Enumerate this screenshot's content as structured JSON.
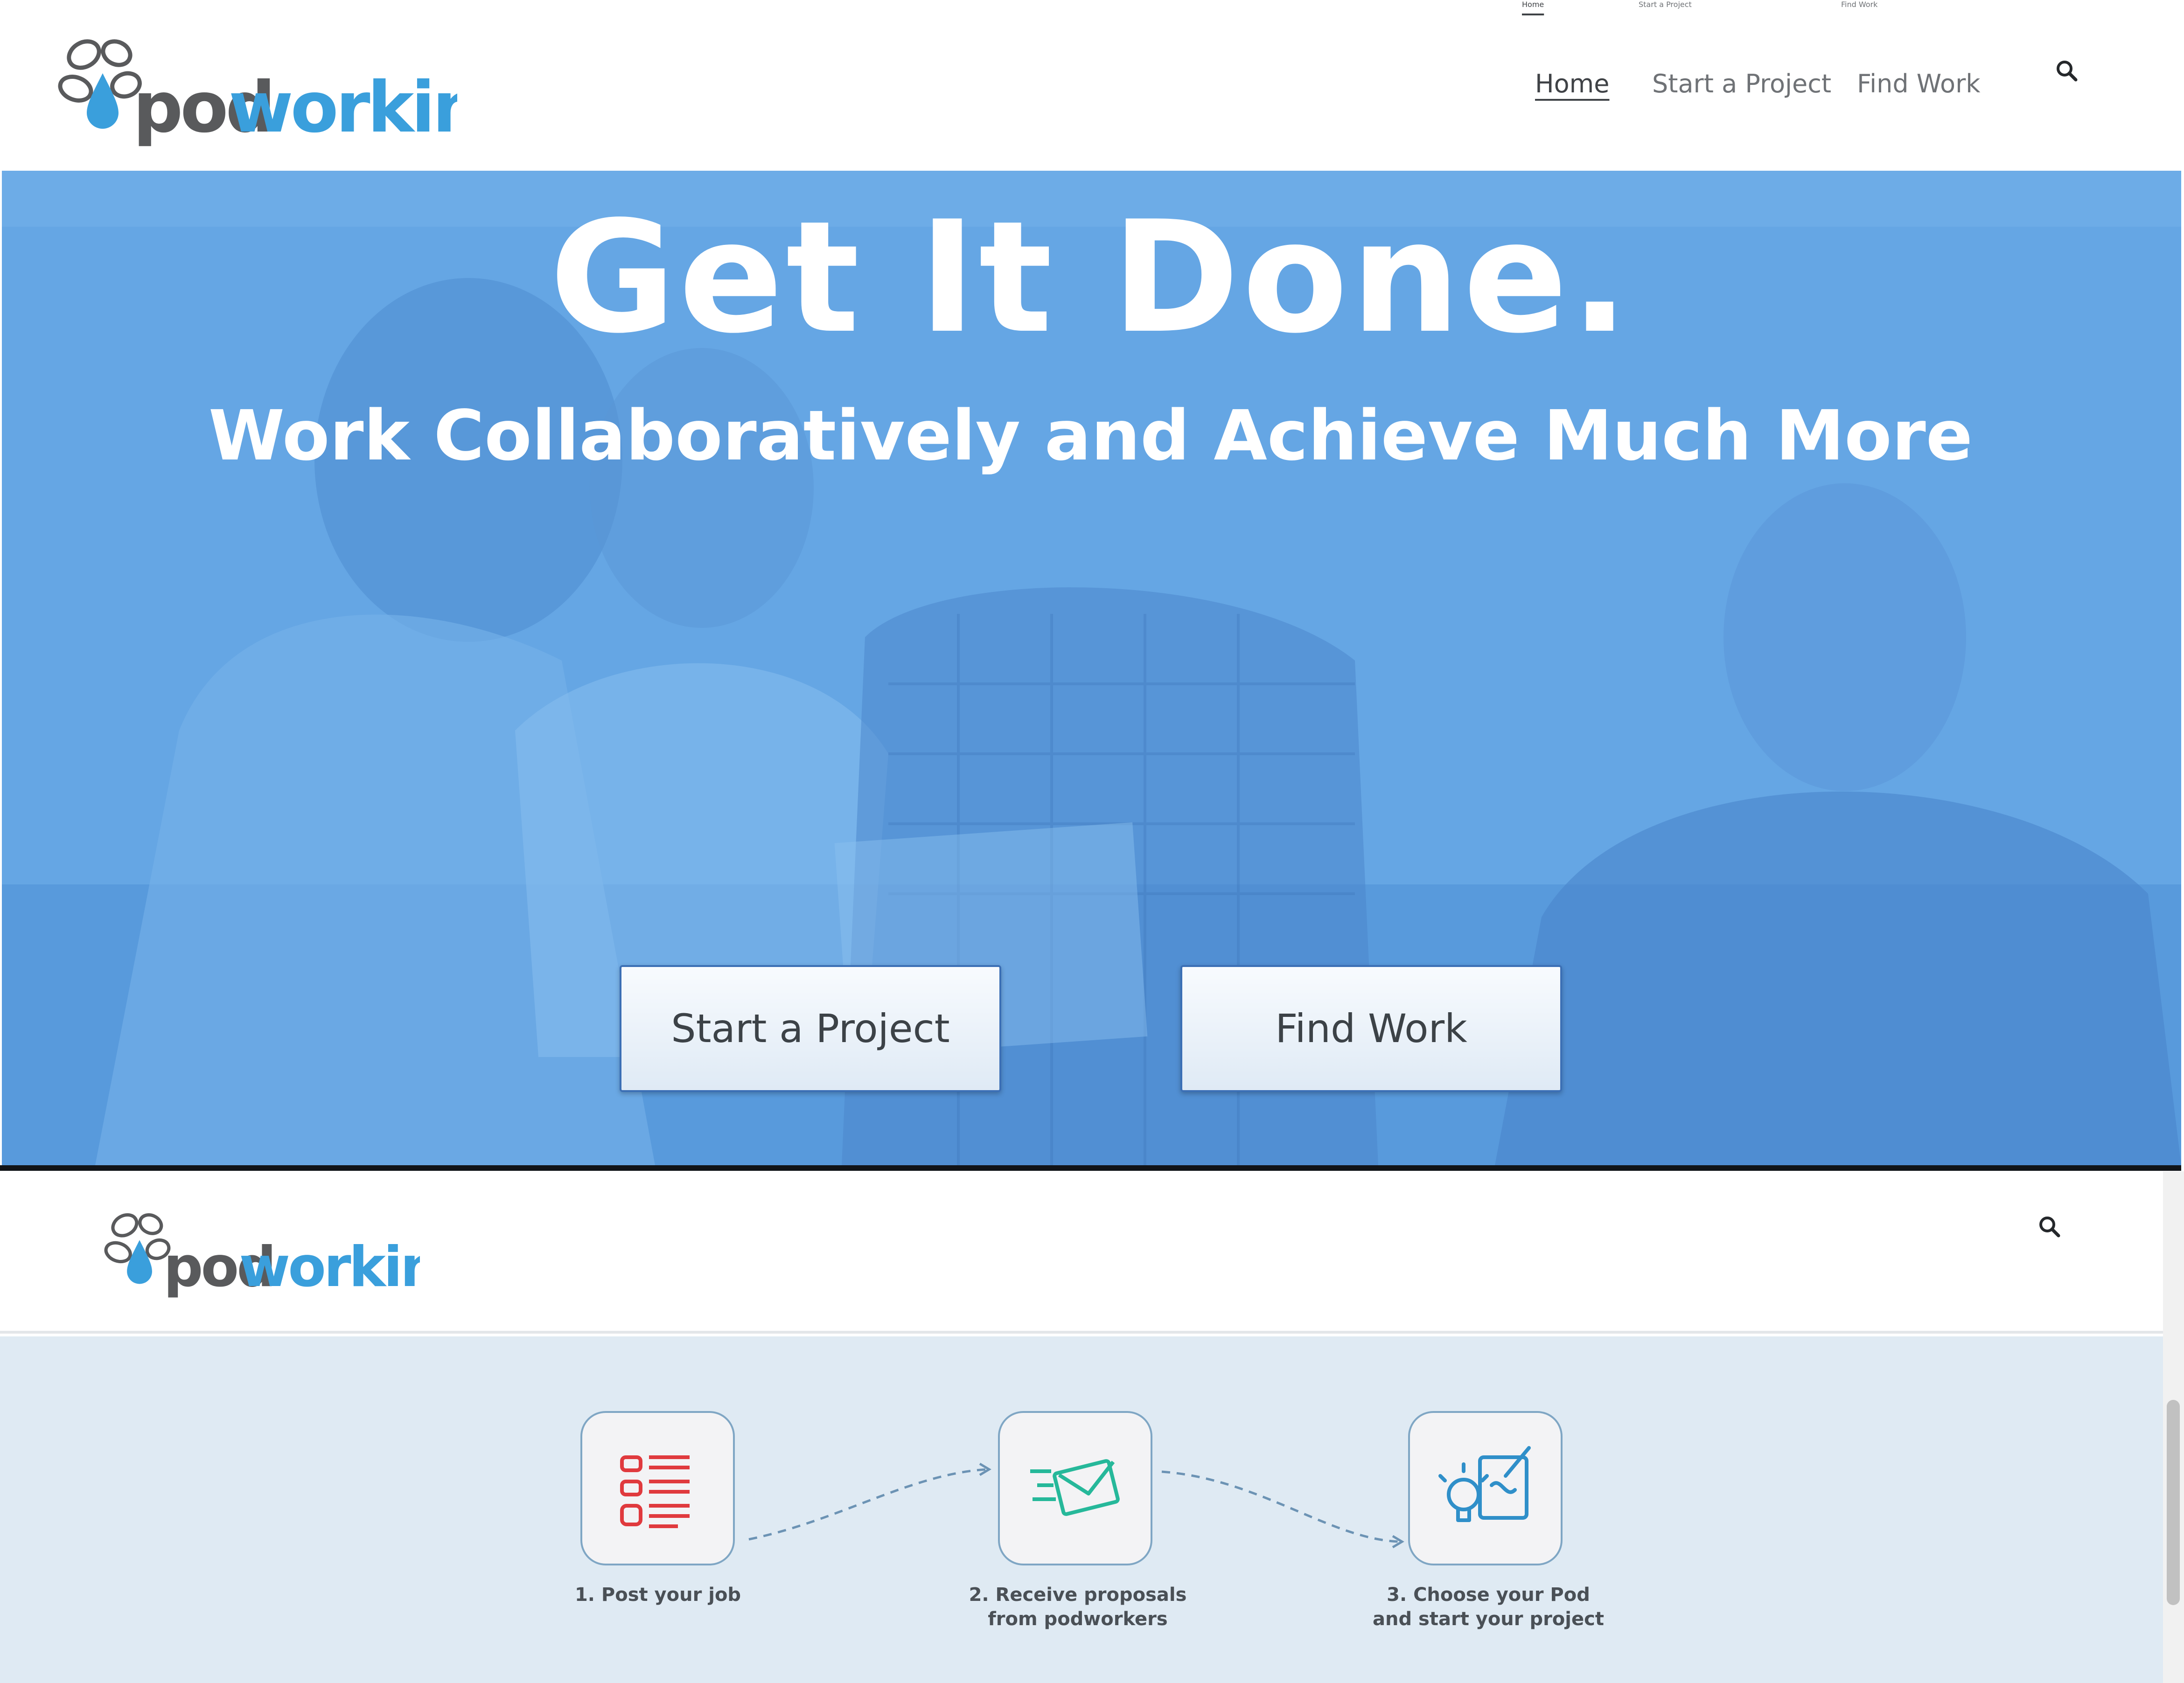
{
  "brand": {
    "logo_pod": "pod",
    "logo_working": "working",
    "accent_color": "#3a9fdc",
    "logo_dark_color": "#595a5c"
  },
  "header": {
    "nav": [
      {
        "label": "Home",
        "active": true
      },
      {
        "label": "Start a Project",
        "active": false
      },
      {
        "label": "Find Work",
        "active": false
      }
    ],
    "search_icon": "search-icon"
  },
  "hero": {
    "title": "Get It Done.",
    "subtitle": "Work Collaboratively and Achieve Much More",
    "buttons": [
      {
        "label": "Start a Project"
      },
      {
        "label": "Find Work"
      }
    ],
    "overlay_color": "#5d9ee0"
  },
  "steps": {
    "items": [
      {
        "line1": "1. Post your job",
        "line2": "",
        "icon": "checklist-icon",
        "icon_color": "#e03a3e"
      },
      {
        "line1": "2. Receive proposals",
        "line2": "from podworkers",
        "icon": "envelope-icon",
        "icon_color": "#26b89a"
      },
      {
        "line1": "3. Choose your Pod",
        "line2": "and start your project",
        "icon": "idea-icon",
        "icon_color": "#2f8fc9"
      }
    ]
  }
}
